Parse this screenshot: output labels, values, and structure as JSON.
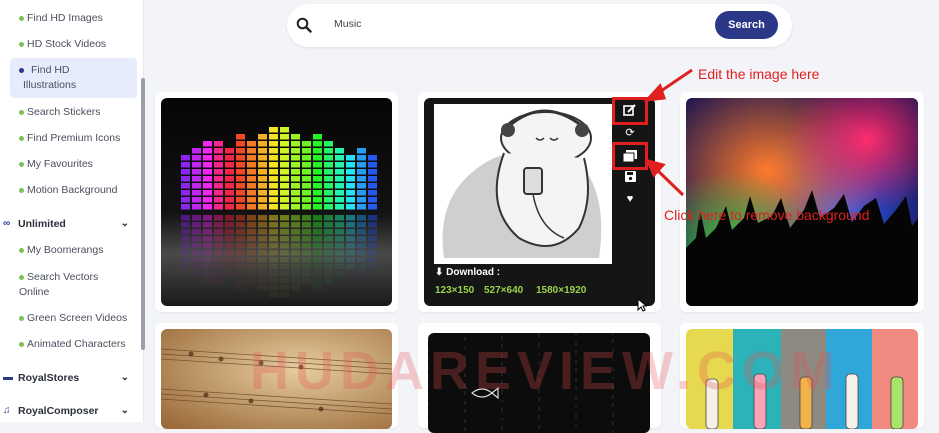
{
  "sidebar": {
    "items": [
      {
        "label": "Find HD Images"
      },
      {
        "label": "HD Stock Videos"
      },
      {
        "label": "Find HD Illustrations",
        "line1": "Find HD",
        "line2": "Illustrations",
        "active": true
      },
      {
        "label": "Search Stickers"
      },
      {
        "label": "Find Premium Icons"
      },
      {
        "label": "My Favourites"
      },
      {
        "label": "Motion Background"
      }
    ],
    "groups": [
      {
        "label": "Unlimited",
        "icon": "infinity-icon"
      },
      {
        "label": "RoyalStores",
        "icon": "store-icon"
      },
      {
        "label": "RoyalComposer",
        "icon": "music-note-icon"
      }
    ],
    "unlimited_items": [
      {
        "label": "My Boomerangs"
      },
      {
        "label": "Search Vectors Online",
        "line1": "Search Vectors",
        "line2": "Online"
      },
      {
        "label": "Green Screen Videos"
      },
      {
        "label": "Animated Characters"
      }
    ]
  },
  "search": {
    "value": "Music",
    "button": "Search"
  },
  "download": {
    "title": "Download :",
    "sizes": [
      "123×150",
      "527×640",
      "1580×1920"
    ]
  },
  "annotations": {
    "edit": "Edit the image here",
    "remove_bg": "Click here to remove background"
  },
  "watermark": "HUDAREVIEW.COM",
  "colors": {
    "accent": "#2b3787",
    "annotation_red": "#e02020",
    "size_green": "#9ad34a"
  }
}
